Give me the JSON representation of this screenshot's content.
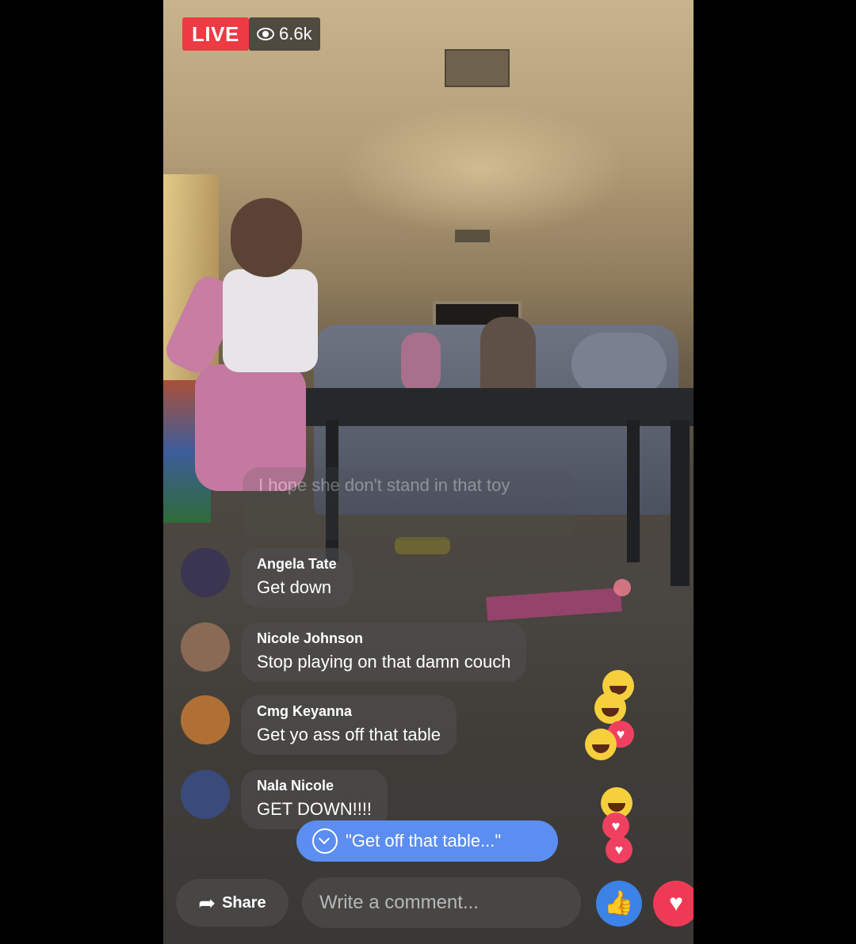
{
  "header": {
    "live_label": "LIVE",
    "viewer_count": "6.6k"
  },
  "comments": [
    {
      "name": "",
      "text": "I hope she don't stand in that toy",
      "faded": true
    },
    {
      "name": "Angela Tate",
      "text": "Get down",
      "avatar_color": "#3a3550"
    },
    {
      "name": "Nicole Johnson",
      "text": "Stop playing on that damn couch",
      "avatar_color": "#8a6a55"
    },
    {
      "name": "Cmg Keyanna",
      "text": "Get yo ass off that table",
      "avatar_color": "#b07035"
    },
    {
      "name": "Nala Nicole",
      "text": "GET DOWN!!!!",
      "avatar_color": "#3a4a7a"
    }
  ],
  "jump_pill": {
    "text": "\"Get off that table...\""
  },
  "footer": {
    "share_label": "Share",
    "comment_placeholder": "Write a comment...",
    "like_icon": "thumbs-up-icon",
    "love_icon": "heart-icon"
  },
  "colors": {
    "live_red": "#ee3a43",
    "like_blue": "#3b83e6",
    "love_red": "#ef3a56",
    "pill_blue": "#5b8ef0"
  }
}
